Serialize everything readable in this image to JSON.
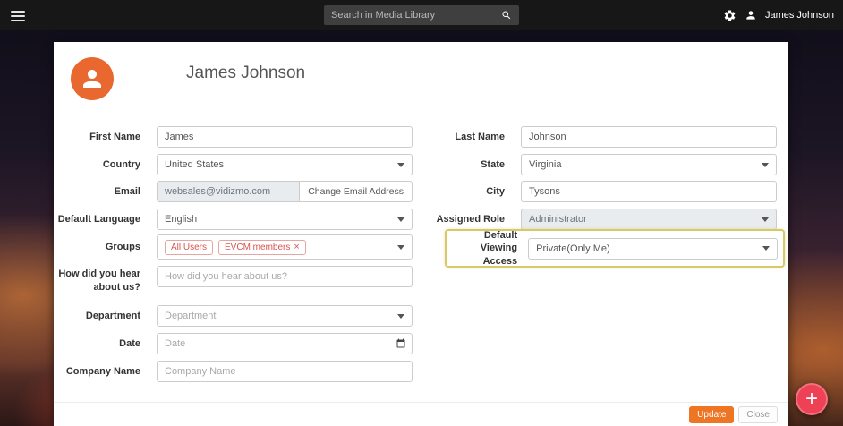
{
  "topbar": {
    "search_placeholder": "Search in Media Library",
    "user_name": "James Johnson"
  },
  "card": {
    "title": "James Johnson"
  },
  "form": {
    "first_name": {
      "label": "First Name",
      "value": "James"
    },
    "country": {
      "label": "Country",
      "value": "United States"
    },
    "email": {
      "label": "Email",
      "value": "websales@vidizmo.com",
      "button": "Change Email Address"
    },
    "default_language": {
      "label": "Default Language",
      "value": "English"
    },
    "groups": {
      "label": "Groups",
      "remove_icon": "×",
      "tags": [
        {
          "text": "All Users"
        },
        {
          "text": "EVCM members"
        }
      ]
    },
    "hear_about": {
      "label": "How did you hear about us?",
      "placeholder": "How did you hear about us?"
    },
    "department": {
      "label": "Department",
      "value": "Department"
    },
    "date": {
      "label": "Date",
      "placeholder": "Date"
    },
    "company_name": {
      "label": "Company Name",
      "placeholder": "Company Name"
    },
    "last_name": {
      "label": "Last Name",
      "value": "Johnson"
    },
    "state": {
      "label": "State",
      "value": "Virginia"
    },
    "city": {
      "label": "City",
      "value": "Tysons"
    },
    "assigned_role": {
      "label": "Assigned Role",
      "value": "Administrator"
    },
    "default_viewing_access": {
      "label_line1": "Default Viewing",
      "label_line2": "Access",
      "value": "Private(Only Me)"
    }
  },
  "actions": {
    "update": "Update",
    "close": "Close"
  },
  "fab": {
    "plus": "+"
  },
  "colors": {
    "accent_orange": "#E8682F",
    "update_orange": "#ED7524",
    "fab_red": "#EF4156",
    "highlight_border": "#D9C868",
    "tag_red": "#D9534F"
  }
}
